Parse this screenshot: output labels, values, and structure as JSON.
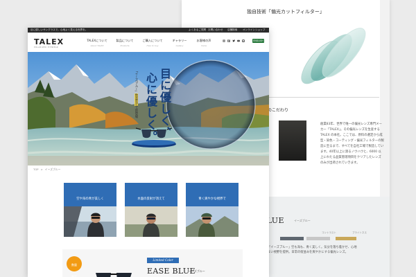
{
  "colors": {
    "brand_blue": "#2f6db5",
    "headline_navy": "#173f7a",
    "highlight_yellow": "#f0d84c",
    "badge_orange": "#f29b14",
    "english_button_green": "#2a7a3e"
  },
  "back_page": {
    "title": "独自技術「偏光カットフィルター」",
    "section_heading": "へのこだわり",
    "paragraph": "創業83年、世界で唯一の偏光レンズ専門メーカー「TALEX」。その偏光レンズを生産する TALEX の本社。ここでは、原料の選定から成型・染色・コーティング・偏光フィルターの製造に至るまで、すべてを自社工場で製造しています。40年以上に渡るノウハウと、6000 以上にわたる品質管理項目をクリアしたレンズのみが出荷されていきます。",
    "product_title": "BLUE",
    "product_subtitle": "イーズブルー",
    "swatch_labels": [
      "",
      "コントラスト",
      "ブライトネス"
    ],
    "paragraph2": "「イーズブルー」空も海も、青く美しく。気分を落ち着かせ、心地よい視野を提供。日常の街並みを爽やかにする偏光レンズ。"
  },
  "topbar": {
    "left_text": "目に優しいサングラスで、心地よく見える世界を。",
    "links": [
      "よくあるご質問",
      "お問い合わせ",
      "店舗検索",
      "オンラインショップ"
    ]
  },
  "header": {
    "logo": "TALEX",
    "logo_sub": "POLARIZED EYEWEAR",
    "nav": [
      {
        "label": "TALEXについて",
        "en": "About TALEX"
      },
      {
        "label": "製品について",
        "en": "Products"
      },
      {
        "label": "ご購入について",
        "en": "How to buy"
      },
      {
        "label": "ギャラリー",
        "en": "Gallery"
      },
      {
        "label": "お客様の声",
        "en": "Voice"
      }
    ],
    "social_icons": [
      "instagram-icon",
      "facebook-icon",
      "twitter-icon",
      "youtube-icon",
      "line-icon"
    ],
    "english_button": "ENGLISH"
  },
  "hero": {
    "headline_col1": "目に優しく、",
    "headline_col2": "心に優しく。",
    "tagline_prefix": "「イーズブルー」",
    "tagline_highlight": "数量限定",
    "tagline_suffix": "で新登場"
  },
  "breadcrumb": {
    "home": "TOP",
    "separator": ">",
    "current": "イーズブルー"
  },
  "benefits": [
    {
      "line1": "空や海の青が美しく",
      "line2": "鮮明に見えて楽しい。"
    },
    {
      "line1": "水面の反射が消えて",
      "line2": "水中がはっきり見える。"
    },
    {
      "line1": "青く爽やかな視界で",
      "line2": "気分をリラックス。"
    }
  ],
  "product": {
    "badge_line1": "数量",
    "badge_line2": "限定",
    "limited_label": "Limited Color",
    "name": "EASE BLUE",
    "name_sub": "イーズブルー"
  }
}
